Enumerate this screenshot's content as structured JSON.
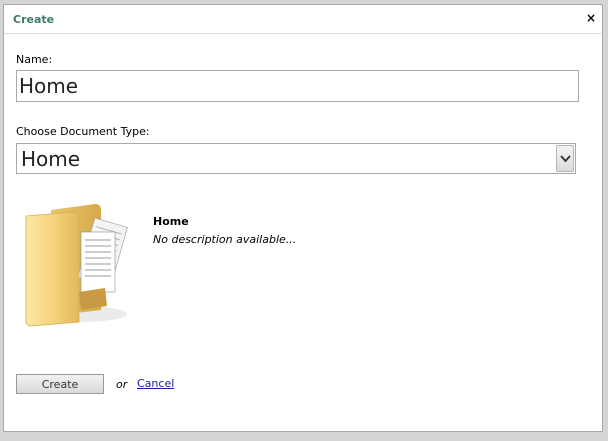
{
  "dialog": {
    "title": "Create",
    "close_glyph": "×",
    "close_icon": "close-icon"
  },
  "form": {
    "name_label": "Name:",
    "name_value": "Home",
    "doctype_label": "Choose Document Type:",
    "doctype_selected": "Home",
    "select_icon": "chevron-down-icon"
  },
  "preview": {
    "icon": "folder-documents-icon",
    "title": "Home",
    "description": "No description available..."
  },
  "actions": {
    "create_label": "Create",
    "or_text": "or",
    "cancel_label": "Cancel"
  },
  "colors": {
    "title": "#3c7c6c",
    "link": "#1a1aa6"
  }
}
